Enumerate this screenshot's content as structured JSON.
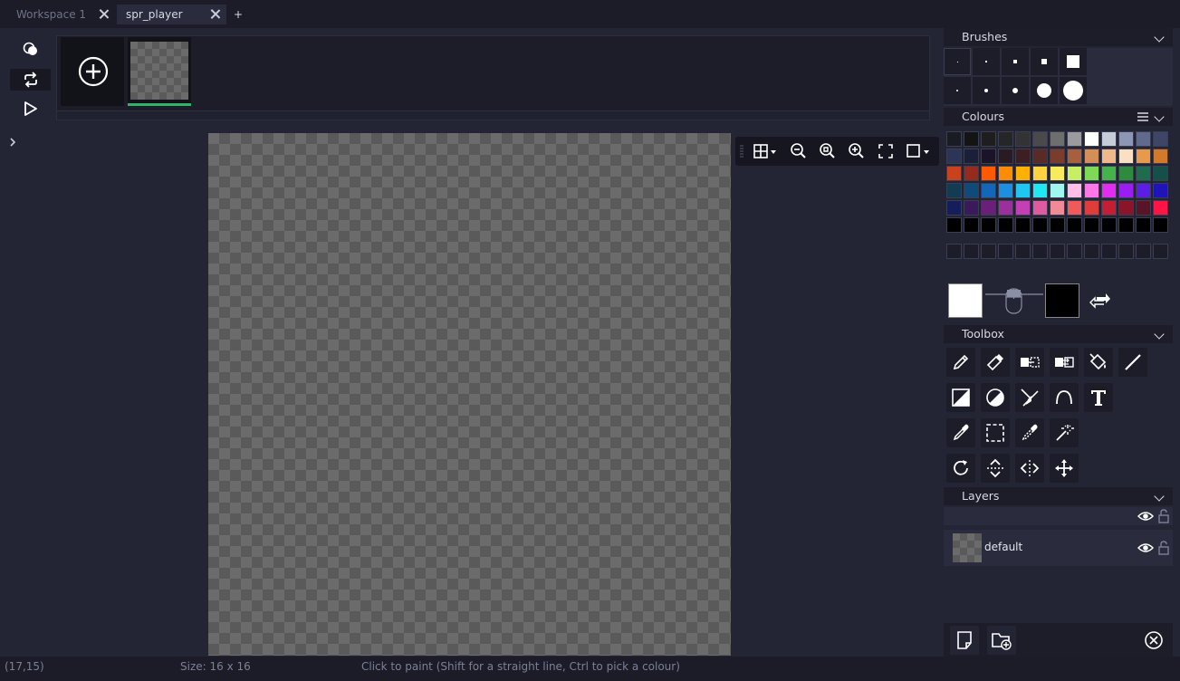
{
  "tabs": [
    {
      "label": "Workspace 1",
      "active": false
    },
    {
      "label": "spr_player",
      "active": true
    }
  ],
  "add_tab_label": "+",
  "panels": {
    "brushes": "Brushes",
    "colours": "Colours",
    "toolbox": "Toolbox",
    "layers": "Layers"
  },
  "palette": [
    [
      "#1b1b24",
      "#141414",
      "#1e1e1e",
      "#262626",
      "#333333",
      "#4a4a4a",
      "#6e6e6e",
      "#9b9b9b",
      "#ffffff",
      "#c7ccd9",
      "#8d96b4",
      "#5f6a8d",
      "#3d4666"
    ],
    [
      "#2d3556",
      "#1c1f38",
      "#1b1428",
      "#2a1a22",
      "#3c1f22",
      "#5a2a24",
      "#7a3c2c",
      "#a85f3d",
      "#d48e5a",
      "#f0b88a",
      "#f9e0c5",
      "#e89a4b",
      "#d17a2b"
    ],
    [
      "#c9421e",
      "#962a1c",
      "#ff5a00",
      "#ff8c00",
      "#ffb000",
      "#ffd23f",
      "#f7ea5c",
      "#c8ef64",
      "#7ed957",
      "#43b34a",
      "#2d8a3e",
      "#1f6b4d",
      "#145048"
    ],
    [
      "#123b54",
      "#0e4a7a",
      "#1467b8",
      "#1d8fe0",
      "#1fc6f0",
      "#20e8f0",
      "#9ff7f0",
      "#ffbee8",
      "#ff76e8",
      "#e02ef0",
      "#9b1ef0",
      "#5a1ee6",
      "#1e14b8"
    ],
    [
      "#141e5a",
      "#3a1a5a",
      "#6a1f7a",
      "#9b2f9b",
      "#c43fb4",
      "#e05aa0",
      "#f08a96",
      "#f05a5a",
      "#e03c3c",
      "#c41e32",
      "#8a1428",
      "#5a1428",
      "#ff1446"
    ],
    [
      "#000000",
      "#000000",
      "#000000",
      "#000000",
      "#000000",
      "#000000",
      "#000000",
      "#000000",
      "#000000",
      "#000000",
      "#000000",
      "#000000",
      "#000000"
    ]
  ],
  "primary_colour": "#ffffff",
  "secondary_colour": "#000000",
  "layers": [
    {
      "name": "default",
      "visible": true,
      "locked": false
    }
  ],
  "status": {
    "cursor": "(17,15)",
    "size": "Size: 16 x 16",
    "hint": "Click to paint (Shift for a straight line, Ctrl to pick a colour)"
  }
}
